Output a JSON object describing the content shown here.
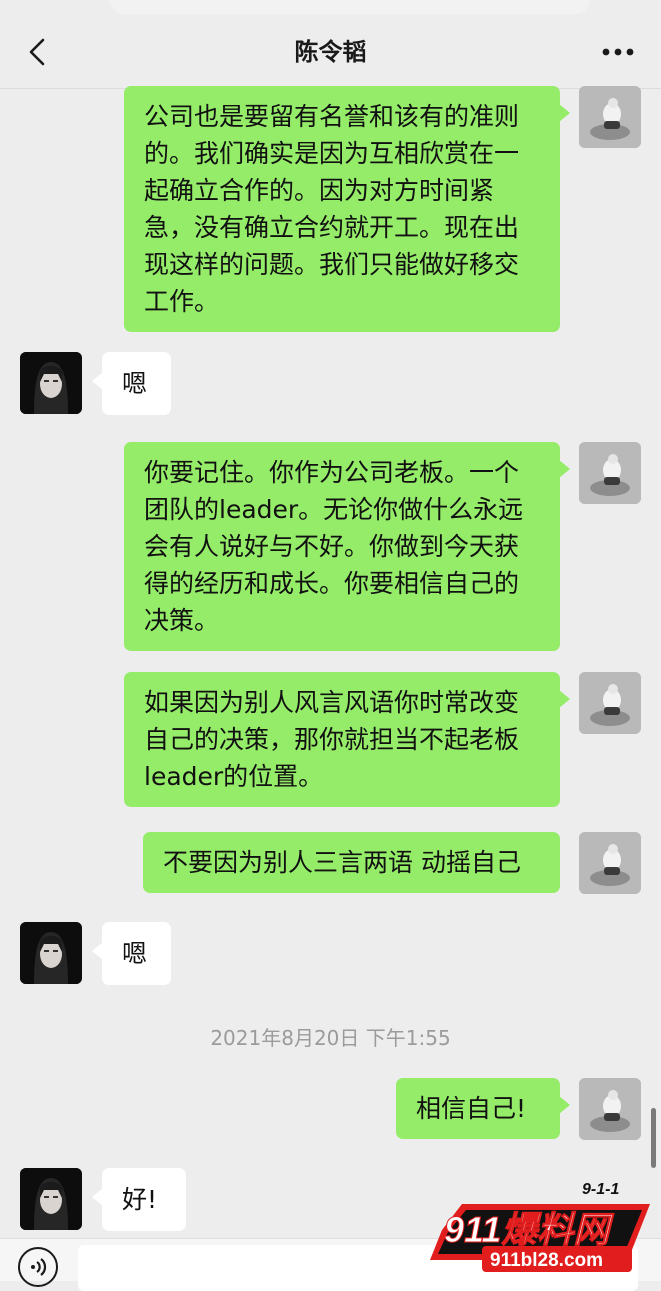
{
  "header": {
    "title": "陈令韬",
    "back_icon": "chevron-left-icon",
    "more_icon": "more-dots-icon"
  },
  "messages": [
    {
      "sender": "me",
      "text": "公司也是要留有名誉和该有的准则\n的。我们确实是因为互相欣赏在一\n起确立合作的。因为对方时间紧\n急，没有确立合约就开工。现在出\n现这样的问题。我们只能做好移交\n工作。"
    },
    {
      "sender": "other",
      "text": "嗯"
    },
    {
      "sender": "me",
      "text": "你要记住。你作为公司老板。一个\n团队的leader。无论你做什么永远\n会有人说好与不好。你做到今天获\n得的经历和成长。你要相信自己的\n决策。"
    },
    {
      "sender": "me",
      "text": "如果因为别人风言风语你时常改变\n自己的决策，那你就担当不起老板\nleader的位置。"
    },
    {
      "sender": "me",
      "text": "不要因为别人三言两语 动摇自己"
    },
    {
      "sender": "other",
      "text": "嗯"
    },
    {
      "sender": "me",
      "text": "相信自己!"
    },
    {
      "sender": "other",
      "text": "好!"
    }
  ],
  "timestamp": "2021年8月20日 下午1:55",
  "input_bar": {
    "voice_icon": "voice-icon",
    "placeholder": ""
  },
  "watermark": {
    "badge": "9-1-1",
    "brand": "911爆料网",
    "url": "911bl28.com"
  },
  "colors": {
    "my_bubble": "#95ec69",
    "other_bubble": "#ffffff",
    "background": "#ededed"
  }
}
